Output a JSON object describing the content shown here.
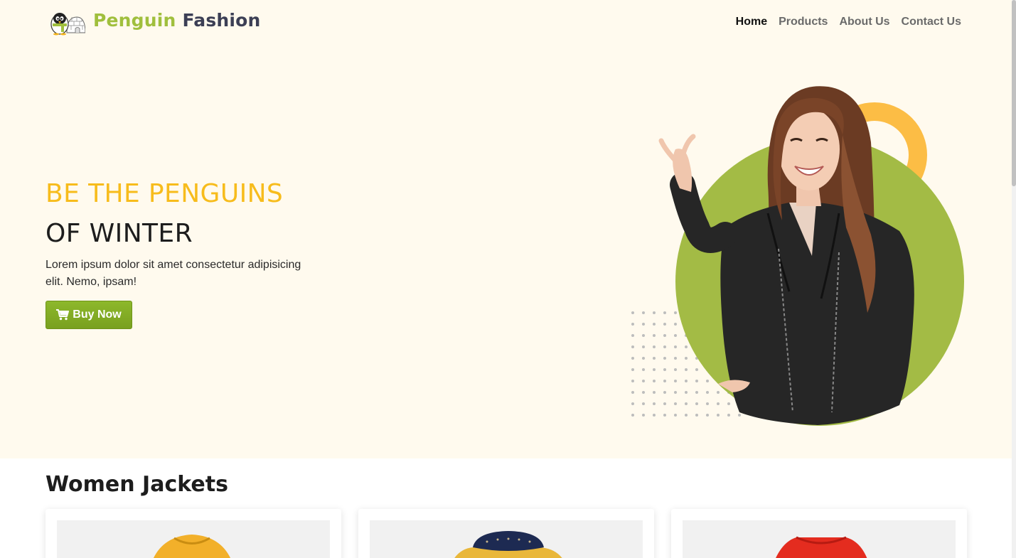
{
  "navbar": {
    "logo_icon": "penguin-igloo-logo",
    "brand_part1": "Penguin",
    "brand_part2": "Fashion",
    "links": [
      "Home",
      "Products",
      "About Us",
      "Contact Us"
    ],
    "active_link": "Home"
  },
  "hero": {
    "heading_highlight": "BE THE PENGUINS",
    "heading_main": "OF WINTER",
    "description": "Lorem ipsum dolor sit amet consectetur adipisicing elit. Nemo, ipsam!",
    "buy_button": "Buy Now",
    "buy_icon": "shopping-cart-icon",
    "model_image": "smiling woman in black leather jacket"
  },
  "section": {
    "title": "Women Jackets",
    "products": [
      {
        "image": "yellow-jacket"
      },
      {
        "image": "navy-yellow-jacket"
      },
      {
        "image": "red-jacket"
      }
    ]
  },
  "colors": {
    "accent_green": "#a0bf3d",
    "accent_yellow": "#f7bc1c",
    "brand_dark": "#3c3f55",
    "hero_bg": "#fffaee",
    "ring_orange": "#fcbd45"
  }
}
